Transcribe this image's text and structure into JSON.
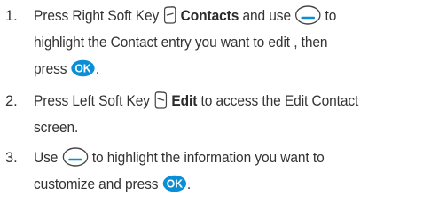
{
  "steps": [
    {
      "number": "1.",
      "parts": {
        "a": "Press Right Soft Key",
        "b": "Contacts",
        "c": "and use",
        "d": "to",
        "e": "highlight the Contact entry you want to edit , then",
        "f": "press",
        "g": "."
      }
    },
    {
      "number": "2.",
      "parts": {
        "a": "Press Left Soft Key",
        "b": "Edit",
        "c": "to access the Edit Contact",
        "d": "screen."
      }
    },
    {
      "number": "3.",
      "parts": {
        "a": "Use",
        "b": "to highlight the information you want to",
        "c": "customize and press",
        "d": "."
      }
    }
  ],
  "icons": {
    "right_soft_key": "right-soft-key-icon",
    "left_soft_key": "left-soft-key-icon",
    "navigation_key": "navigation-key-icon",
    "ok_key": "ok-key-icon",
    "ok_key_label": "OK"
  },
  "colors": {
    "text": "#333333",
    "icon_fill": "#0a8fd6",
    "icon_stroke": "#0a8fd6"
  }
}
